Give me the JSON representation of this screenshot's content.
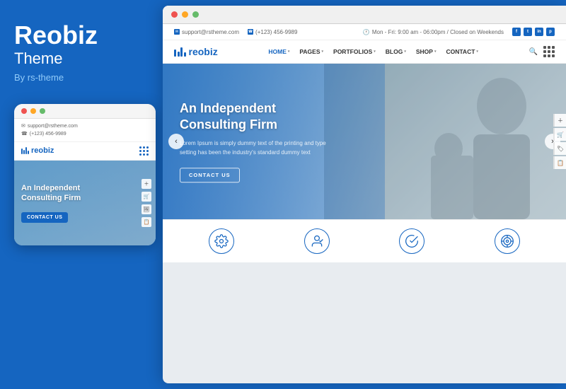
{
  "left": {
    "brand_name": "Reobiz",
    "brand_subtitle": "Theme",
    "brand_by": "By rs-theme"
  },
  "mobile": {
    "dots": [
      {
        "color": "#EF5350"
      },
      {
        "color": "#FFA726"
      },
      {
        "color": "#66BB6A"
      }
    ],
    "info_lines": [
      {
        "icon": "✉",
        "text": "support@rstheme.com"
      },
      {
        "icon": "☎",
        "text": "(+123) 456-9989"
      }
    ],
    "logo_text": "reobiz",
    "hero_title": "An Independent\nConsulting Firm",
    "hero_btn": "CONTACT US",
    "side_icons": [
      "+",
      "🛒",
      "🖼",
      "📋"
    ]
  },
  "browser": {
    "dots": [
      {
        "color": "#EF5350"
      },
      {
        "color": "#FFA726"
      },
      {
        "color": "#66BB6A"
      }
    ]
  },
  "topbar": {
    "email": "support@rstheme.com",
    "phone": "(+123) 456-9989",
    "hours": "Mon - Fri: 9:00 am - 06:00pm / Closed on Weekends",
    "socials": [
      "f",
      "t",
      "in",
      "p"
    ]
  },
  "nav": {
    "logo_text": "reobiz",
    "items": [
      {
        "label": "HOME",
        "has_dropdown": true,
        "active": true
      },
      {
        "label": "PAGES",
        "has_dropdown": true,
        "active": false
      },
      {
        "label": "PORTFOLIOS",
        "has_dropdown": true,
        "active": false
      },
      {
        "label": "BLOG",
        "has_dropdown": true,
        "active": false
      },
      {
        "label": "SHOP",
        "has_dropdown": true,
        "active": false
      },
      {
        "label": "CONTACT",
        "has_dropdown": true,
        "active": false
      }
    ]
  },
  "hero": {
    "title": "An Independent\nConsulting Firm",
    "subtitle": "Lorem Ipsum is simply dummy text of the printing and type\nsetting has been the industry's standard dummy text",
    "cta_label": "CONTACT US",
    "side_icons": [
      "+",
      "🛒",
      "🏷",
      "📋"
    ]
  },
  "services": {
    "icons": [
      "⚙",
      "👤",
      "✓",
      "🎯"
    ]
  },
  "colors": {
    "brand_blue": "#1565C0",
    "background_blue": "#1565C0",
    "white": "#ffffff",
    "text_dark": "#333333"
  }
}
